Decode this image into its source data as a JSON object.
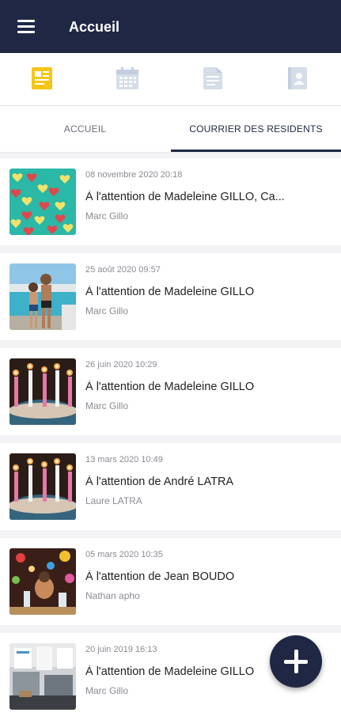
{
  "header": {
    "title": "Accueil",
    "menu_icon": "hamburger-menu-icon"
  },
  "icon_bar": [
    {
      "name": "news-icon",
      "active": true,
      "color": "#f5c518"
    },
    {
      "name": "calendar-icon",
      "active": false,
      "color": "#d5dde9"
    },
    {
      "name": "document-icon",
      "active": false,
      "color": "#d5dde9"
    },
    {
      "name": "contact-book-icon",
      "active": false,
      "color": "#d5dde9"
    }
  ],
  "tabs": [
    {
      "label": "ACCUEIL",
      "active": false
    },
    {
      "label": "COURRIER DES RESIDENTS",
      "active": true
    }
  ],
  "messages": [
    {
      "date": "08 novembre 2020 20:18",
      "subject": "À l'attention de Madeleine GILLO, Ca...",
      "author": "Marc Gillo",
      "thumbnail": "hearts"
    },
    {
      "date": "25 août 2020 09:57",
      "subject": "À l'attention de Madeleine GILLO",
      "author": "Marc Gillo",
      "thumbnail": "pool"
    },
    {
      "date": "26 juin 2020 10:29",
      "subject": "À l'attention de Madeleine GILLO",
      "author": "Marc Gillo",
      "thumbnail": "candles"
    },
    {
      "date": "13 mars 2020 10:49",
      "subject": "À l'attention de André LATRA",
      "author": "Laure LATRA",
      "thumbnail": "candles"
    },
    {
      "date": "05 mars 2020 10:35",
      "subject": "À l'attention de Jean BOUDO",
      "author": "Nathan apho",
      "thumbnail": "party"
    },
    {
      "date": "20 juin 2019 16:13",
      "subject": "À l'attention de Madeleine GILLO",
      "author": "Marc Gillo",
      "thumbnail": "room"
    }
  ],
  "fab": {
    "icon": "plus-icon"
  },
  "colors": {
    "primary": "#1f2744",
    "accent": "#f5c518"
  }
}
